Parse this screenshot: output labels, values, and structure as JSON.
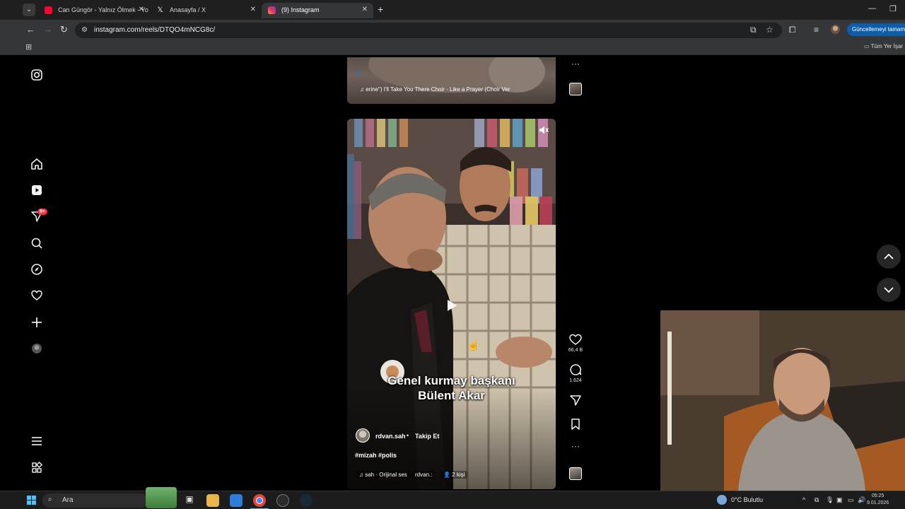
{
  "browser": {
    "tabs": [
      {
        "title": "Can Güngör - Yalnız Ölmek - Yo",
        "favicon_color": "#ff0033"
      },
      {
        "title": "Anasayfa / X",
        "favicon_color": "#ffffff"
      },
      {
        "title": "(9) Instagram",
        "favicon_color": "#e1306c"
      }
    ],
    "url": "instagram.com/reels/DTQO4mNCG8c/",
    "update_button": "Güncellemeyi tamamla",
    "all_bookmarks": "Tüm Yer İşar"
  },
  "sidebar": {
    "notification_badge": "9+",
    "items": [
      "instagram-logo",
      "home",
      "reels",
      "messages",
      "search",
      "explore",
      "notifications",
      "create",
      "profile",
      "more",
      "also-from-meta"
    ]
  },
  "prev_reel": {
    "audio_text": "erine\")  I'll Take You There Choir - Like a Prayer (Choir Ver"
  },
  "reel": {
    "caption_line1": "Genel kurmay başkanı",
    "caption_line2": "Bülent Akar",
    "username": "rdvan.sah",
    "separator": "•",
    "follow": "Takip Et",
    "hashtags": "#mizah #polis",
    "audio": "sah · Orijinal ses",
    "audio_user": "rdvan.:",
    "people": "2 kişi",
    "likes": "66,4 B",
    "comments": "1.624"
  },
  "taskbar": {
    "search_label": "Ara",
    "weather": "0°C  Bulutlu",
    "time": "05:25",
    "date": "9.01.2026"
  },
  "colors": {
    "accent": "#0d5da8",
    "badge": "#ff3040"
  }
}
